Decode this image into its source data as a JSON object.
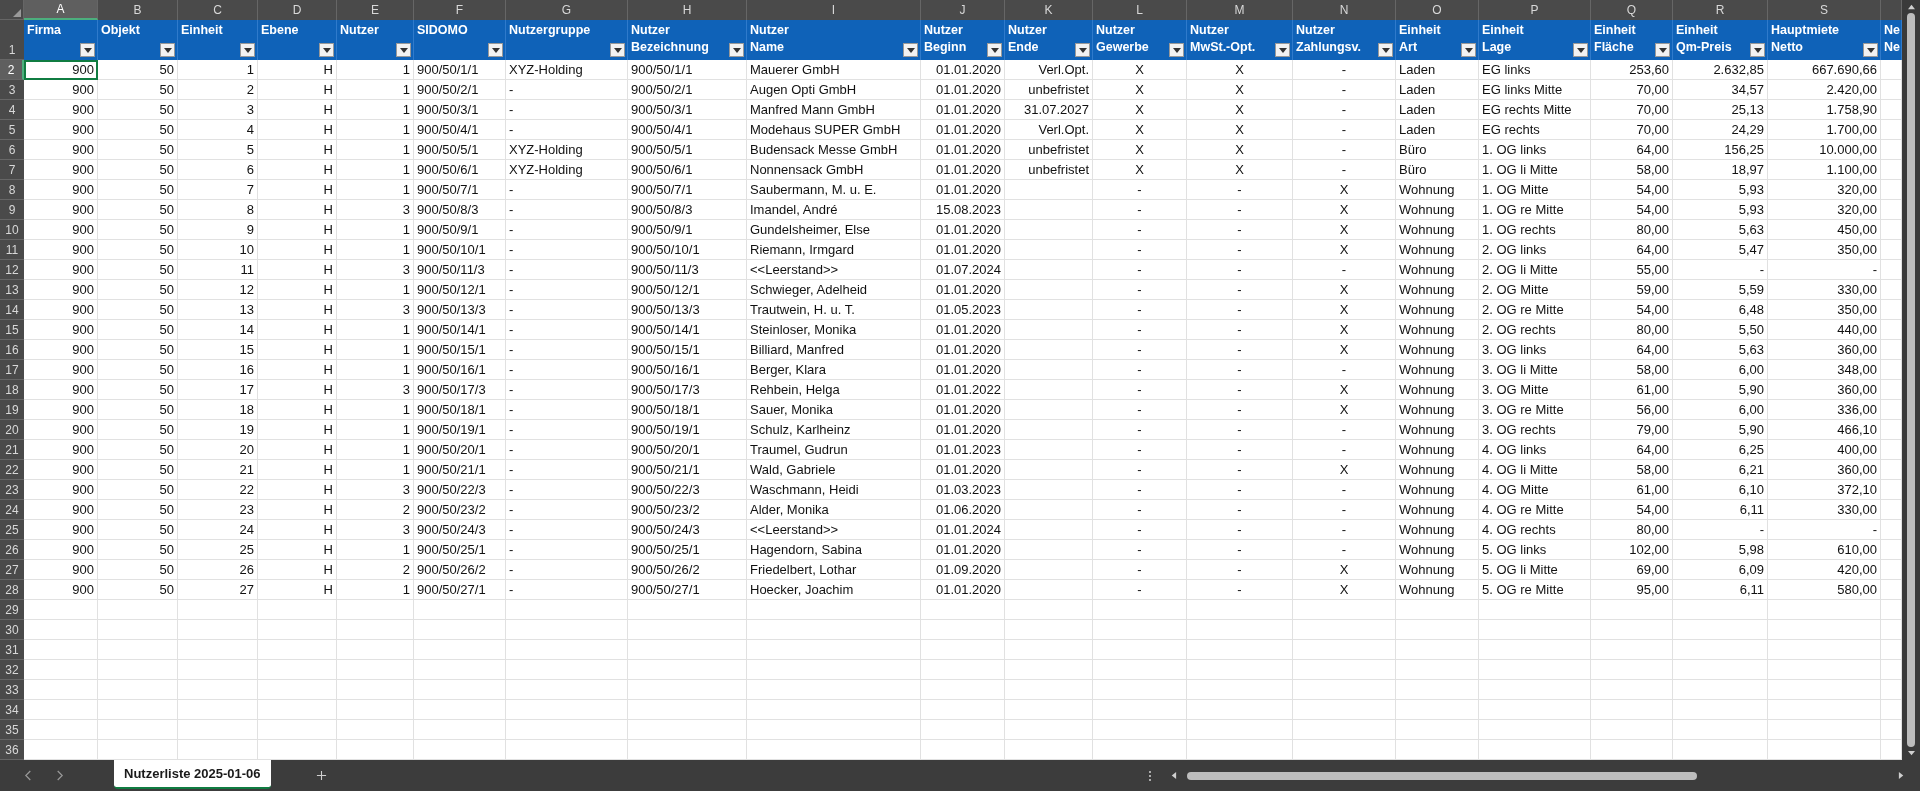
{
  "columns": [
    {
      "letter": "A",
      "selected": true,
      "kind": "number",
      "header": [
        "Firma"
      ],
      "filter": true
    },
    {
      "letter": "B",
      "selected": false,
      "kind": "number",
      "header": [
        "Objekt"
      ],
      "filter": true
    },
    {
      "letter": "C",
      "selected": false,
      "kind": "number",
      "header": [
        "Einheit"
      ],
      "filter": true
    },
    {
      "letter": "D",
      "selected": false,
      "kind": "number",
      "header": [
        "Ebene"
      ],
      "filter": true
    },
    {
      "letter": "E",
      "selected": false,
      "kind": "number",
      "header": [
        "Nutzer"
      ],
      "filter": true
    },
    {
      "letter": "F",
      "selected": false,
      "kind": "text",
      "header": [
        "SIDOMO"
      ],
      "filter": true
    },
    {
      "letter": "G",
      "selected": false,
      "kind": "text",
      "header": [
        "Nutzergruppe"
      ],
      "filter": true
    },
    {
      "letter": "H",
      "selected": false,
      "kind": "text",
      "header": [
        "Nutzer",
        "Bezeichnung"
      ],
      "filter": true
    },
    {
      "letter": "I",
      "selected": false,
      "kind": "text",
      "header": [
        "Nutzer",
        "Name"
      ],
      "filter": true
    },
    {
      "letter": "J",
      "selected": false,
      "kind": "number",
      "header": [
        "Nutzer",
        "Beginn"
      ],
      "filter": true
    },
    {
      "letter": "K",
      "selected": false,
      "kind": "number",
      "header": [
        "Nutzer",
        "Ende"
      ],
      "filter": true
    },
    {
      "letter": "L",
      "selected": false,
      "kind": "flag",
      "header": [
        "Nutzer",
        "Gewerbe"
      ],
      "filter": true
    },
    {
      "letter": "M",
      "selected": false,
      "kind": "flag",
      "header": [
        "Nutzer",
        "MwSt.-Opt."
      ],
      "filter": true
    },
    {
      "letter": "N",
      "selected": false,
      "kind": "flag",
      "header": [
        "Nutzer",
        "Zahlungsv."
      ],
      "filter": true
    },
    {
      "letter": "O",
      "selected": false,
      "kind": "text",
      "header": [
        "Einheit",
        "Art"
      ],
      "filter": true
    },
    {
      "letter": "P",
      "selected": false,
      "kind": "text",
      "header": [
        "Einheit",
        "Lage"
      ],
      "filter": true
    },
    {
      "letter": "Q",
      "selected": false,
      "kind": "number",
      "header": [
        "Einheit",
        "Fläche"
      ],
      "filter": true
    },
    {
      "letter": "R",
      "selected": false,
      "kind": "number",
      "header": [
        "Einheit",
        "Qm-Preis"
      ],
      "filter": true
    },
    {
      "letter": "S",
      "selected": false,
      "kind": "number",
      "header": [
        "Hauptmiete",
        "Netto"
      ],
      "filter": true
    },
    {
      "selected": false,
      "kind": "text",
      "header": [
        "Ne",
        "Ne"
      ],
      "filter": false
    }
  ],
  "header_row_number": "1",
  "rows": [
    {
      "number": "2",
      "selected": true,
      "cells": [
        "900",
        "50",
        "1",
        "H",
        "1",
        "900/50/1/1",
        "XYZ-Holding",
        "900/50/1/1",
        "Mauerer GmbH",
        "01.01.2020",
        "Verl.Opt.",
        "X",
        "X",
        "-",
        "Laden",
        "EG links",
        "253,60",
        "2.632,85",
        "667.690,66"
      ]
    },
    {
      "number": "3",
      "selected": false,
      "cells": [
        "900",
        "50",
        "2",
        "H",
        "1",
        "900/50/2/1",
        "-",
        "900/50/2/1",
        "Augen Opti GmbH",
        "01.01.2020",
        "unbefristet",
        "X",
        "X",
        "-",
        "Laden",
        "EG links Mitte",
        "70,00",
        "34,57",
        "2.420,00"
      ]
    },
    {
      "number": "4",
      "selected": false,
      "cells": [
        "900",
        "50",
        "3",
        "H",
        "1",
        "900/50/3/1",
        "-",
        "900/50/3/1",
        "Manfred Mann GmbH",
        "01.01.2020",
        "31.07.2027",
        "X",
        "X",
        "-",
        "Laden",
        "EG rechts Mitte",
        "70,00",
        "25,13",
        "1.758,90"
      ]
    },
    {
      "number": "5",
      "selected": false,
      "cells": [
        "900",
        "50",
        "4",
        "H",
        "1",
        "900/50/4/1",
        "-",
        "900/50/4/1",
        "Modehaus SUPER GmbH",
        "01.01.2020",
        "Verl.Opt.",
        "X",
        "X",
        "-",
        "Laden",
        "EG rechts",
        "70,00",
        "24,29",
        "1.700,00"
      ]
    },
    {
      "number": "6",
      "selected": false,
      "cells": [
        "900",
        "50",
        "5",
        "H",
        "1",
        "900/50/5/1",
        "XYZ-Holding",
        "900/50/5/1",
        "Budensack Messe GmbH",
        "01.01.2020",
        "unbefristet",
        "X",
        "X",
        "-",
        "Büro",
        "1. OG links",
        "64,00",
        "156,25",
        "10.000,00"
      ]
    },
    {
      "number": "7",
      "selected": false,
      "cells": [
        "900",
        "50",
        "6",
        "H",
        "1",
        "900/50/6/1",
        "XYZ-Holding",
        "900/50/6/1",
        "Nonnensack GmbH",
        "01.01.2020",
        "unbefristet",
        "X",
        "X",
        "-",
        "Büro",
        "1. OG li Mitte",
        "58,00",
        "18,97",
        "1.100,00"
      ]
    },
    {
      "number": "8",
      "selected": false,
      "cells": [
        "900",
        "50",
        "7",
        "H",
        "1",
        "900/50/7/1",
        "-",
        "900/50/7/1",
        "Saubermann, M. u. E.",
        "01.01.2020",
        null,
        "-",
        "-",
        "X",
        "Wohnung",
        "1. OG Mitte",
        "54,00",
        "5,93",
        "320,00"
      ]
    },
    {
      "number": "9",
      "selected": false,
      "cells": [
        "900",
        "50",
        "8",
        "H",
        "3",
        "900/50/8/3",
        "-",
        "900/50/8/3",
        "Imandel, André",
        "15.08.2023",
        null,
        "-",
        "-",
        "X",
        "Wohnung",
        "1. OG re Mitte",
        "54,00",
        "5,93",
        "320,00"
      ]
    },
    {
      "number": "10",
      "selected": false,
      "cells": [
        "900",
        "50",
        "9",
        "H",
        "1",
        "900/50/9/1",
        "-",
        "900/50/9/1",
        "Gundelsheimer, Else",
        "01.01.2020",
        null,
        "-",
        "-",
        "X",
        "Wohnung",
        "1. OG rechts",
        "80,00",
        "5,63",
        "450,00"
      ]
    },
    {
      "number": "11",
      "selected": false,
      "cells": [
        "900",
        "50",
        "10",
        "H",
        "1",
        "900/50/10/1",
        "-",
        "900/50/10/1",
        "Riemann, Irmgard",
        "01.01.2020",
        null,
        "-",
        "-",
        "X",
        "Wohnung",
        "2. OG links",
        "64,00",
        "5,47",
        "350,00"
      ]
    },
    {
      "number": "12",
      "selected": false,
      "cells": [
        "900",
        "50",
        "11",
        "H",
        "3",
        "900/50/11/3",
        "-",
        "900/50/11/3",
        "<<Leerstand>>",
        "01.07.2024",
        null,
        "-",
        "-",
        "-",
        "Wohnung",
        "2. OG li Mitte",
        "55,00",
        "-",
        "-"
      ]
    },
    {
      "number": "13",
      "selected": false,
      "cells": [
        "900",
        "50",
        "12",
        "H",
        "1",
        "900/50/12/1",
        "-",
        "900/50/12/1",
        "Schwieger, Adelheid",
        "01.01.2020",
        null,
        "-",
        "-",
        "X",
        "Wohnung",
        "2. OG Mitte",
        "59,00",
        "5,59",
        "330,00"
      ]
    },
    {
      "number": "14",
      "selected": false,
      "cells": [
        "900",
        "50",
        "13",
        "H",
        "3",
        "900/50/13/3",
        "-",
        "900/50/13/3",
        "Trautwein, H. u. T.",
        "01.05.2023",
        null,
        "-",
        "-",
        "X",
        "Wohnung",
        "2. OG re Mitte",
        "54,00",
        "6,48",
        "350,00"
      ]
    },
    {
      "number": "15",
      "selected": false,
      "cells": [
        "900",
        "50",
        "14",
        "H",
        "1",
        "900/50/14/1",
        "-",
        "900/50/14/1",
        "Steinloser, Monika",
        "01.01.2020",
        null,
        "-",
        "-",
        "X",
        "Wohnung",
        "2. OG rechts",
        "80,00",
        "5,50",
        "440,00"
      ]
    },
    {
      "number": "16",
      "selected": false,
      "cells": [
        "900",
        "50",
        "15",
        "H",
        "1",
        "900/50/15/1",
        "-",
        "900/50/15/1",
        "Billiard, Manfred",
        "01.01.2020",
        null,
        "-",
        "-",
        "X",
        "Wohnung",
        "3. OG links",
        "64,00",
        "5,63",
        "360,00"
      ]
    },
    {
      "number": "17",
      "selected": false,
      "cells": [
        "900",
        "50",
        "16",
        "H",
        "1",
        "900/50/16/1",
        "-",
        "900/50/16/1",
        "Berger, Klara",
        "01.01.2020",
        null,
        "-",
        "-",
        "-",
        "Wohnung",
        "3. OG li Mitte",
        "58,00",
        "6,00",
        "348,00"
      ]
    },
    {
      "number": "18",
      "selected": false,
      "cells": [
        "900",
        "50",
        "17",
        "H",
        "3",
        "900/50/17/3",
        "-",
        "900/50/17/3",
        "Rehbein, Helga",
        "01.01.2022",
        null,
        "-",
        "-",
        "X",
        "Wohnung",
        "3. OG Mitte",
        "61,00",
        "5,90",
        "360,00"
      ]
    },
    {
      "number": "19",
      "selected": false,
      "cells": [
        "900",
        "50",
        "18",
        "H",
        "1",
        "900/50/18/1",
        "-",
        "900/50/18/1",
        "Sauer, Monika",
        "01.01.2020",
        null,
        "-",
        "-",
        "X",
        "Wohnung",
        "3. OG re Mitte",
        "56,00",
        "6,00",
        "336,00"
      ]
    },
    {
      "number": "20",
      "selected": false,
      "cells": [
        "900",
        "50",
        "19",
        "H",
        "1",
        "900/50/19/1",
        "-",
        "900/50/19/1",
        "Schulz, Karlheinz",
        "01.01.2020",
        null,
        "-",
        "-",
        "-",
        "Wohnung",
        "3. OG rechts",
        "79,00",
        "5,90",
        "466,10"
      ]
    },
    {
      "number": "21",
      "selected": false,
      "cells": [
        "900",
        "50",
        "20",
        "H",
        "1",
        "900/50/20/1",
        "-",
        "900/50/20/1",
        "Traumel, Gudrun",
        "01.01.2023",
        null,
        "-",
        "-",
        "-",
        "Wohnung",
        "4. OG links",
        "64,00",
        "6,25",
        "400,00"
      ]
    },
    {
      "number": "22",
      "selected": false,
      "cells": [
        "900",
        "50",
        "21",
        "H",
        "1",
        "900/50/21/1",
        "-",
        "900/50/21/1",
        "Wald, Gabriele",
        "01.01.2020",
        null,
        "-",
        "-",
        "X",
        "Wohnung",
        "4. OG li Mitte",
        "58,00",
        "6,21",
        "360,00"
      ]
    },
    {
      "number": "23",
      "selected": false,
      "cells": [
        "900",
        "50",
        "22",
        "H",
        "3",
        "900/50/22/3",
        "-",
        "900/50/22/3",
        "Waschmann, Heidi",
        "01.03.2023",
        null,
        "-",
        "-",
        "-",
        "Wohnung",
        "4. OG Mitte",
        "61,00",
        "6,10",
        "372,10"
      ]
    },
    {
      "number": "24",
      "selected": false,
      "cells": [
        "900",
        "50",
        "23",
        "H",
        "2",
        "900/50/23/2",
        "-",
        "900/50/23/2",
        "Alder, Monika",
        "01.06.2020",
        null,
        "-",
        "-",
        "-",
        "Wohnung",
        "4. OG re Mitte",
        "54,00",
        "6,11",
        "330,00"
      ]
    },
    {
      "number": "25",
      "selected": false,
      "cells": [
        "900",
        "50",
        "24",
        "H",
        "3",
        "900/50/24/3",
        "-",
        "900/50/24/3",
        "<<Leerstand>>",
        "01.01.2024",
        null,
        "-",
        "-",
        "-",
        "Wohnung",
        "4. OG rechts",
        "80,00",
        "-",
        "-"
      ]
    },
    {
      "number": "26",
      "selected": false,
      "cells": [
        "900",
        "50",
        "25",
        "H",
        "1",
        "900/50/25/1",
        "-",
        "900/50/25/1",
        "Hagendorn, Sabina",
        "01.01.2020",
        null,
        "-",
        "-",
        "-",
        "Wohnung",
        "5. OG links",
        "102,00",
        "5,98",
        "610,00"
      ]
    },
    {
      "number": "27",
      "selected": false,
      "cells": [
        "900",
        "50",
        "26",
        "H",
        "2",
        "900/50/26/2",
        "-",
        "900/50/26/2",
        "Friedelbert, Lothar",
        "01.09.2020",
        null,
        "-",
        "-",
        "X",
        "Wohnung",
        "5. OG li Mitte",
        "69,00",
        "6,09",
        "420,00"
      ]
    },
    {
      "number": "28",
      "selected": false,
      "cells": [
        "900",
        "50",
        "27",
        "H",
        "1",
        "900/50/27/1",
        "-",
        "900/50/27/1",
        "Hoecker, Joachim",
        "01.01.2020",
        null,
        "-",
        "-",
        "X",
        "Wohnung",
        "5. OG re Mitte",
        "95,00",
        "6,11",
        "580,00"
      ]
    }
  ],
  "empty_rows": [
    "29",
    "30",
    "31",
    "32",
    "33",
    "34",
    "35",
    "36"
  ],
  "sheet_tabs": [
    {
      "label": "Nutzerliste 2025-01-06",
      "selected": true
    }
  ]
}
